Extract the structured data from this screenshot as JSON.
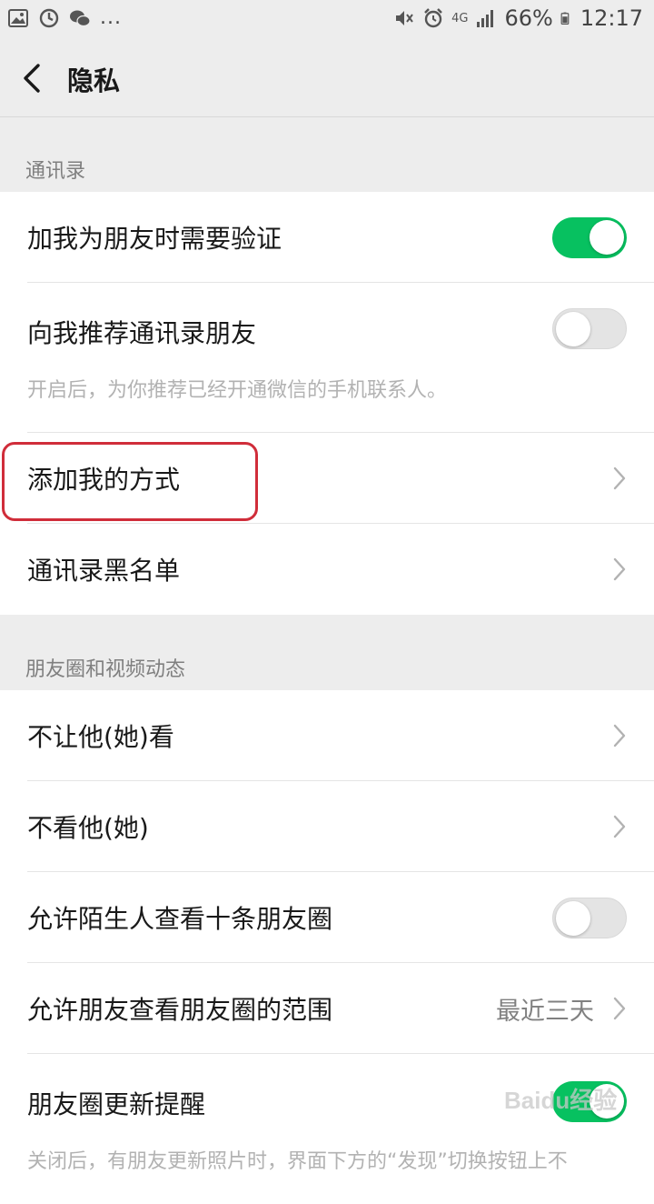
{
  "status_bar": {
    "left_icons": [
      "image-icon",
      "sync-icon",
      "wechat-icon"
    ],
    "more": "...",
    "network": "4G",
    "battery": "66%",
    "time": "12:17"
  },
  "nav": {
    "title": "隐私"
  },
  "sections": {
    "contacts": {
      "label": "通讯录",
      "require_verification": {
        "label": "加我为朋友时需要验证",
        "enabled": true
      },
      "recommend_contacts": {
        "label": "向我推荐通讯录朋友",
        "description": "开启后，为你推荐已经开通微信的手机联系人。",
        "enabled": false
      },
      "add_me_methods": {
        "label": "添加我的方式"
      },
      "blacklist": {
        "label": "通讯录黑名单"
      }
    },
    "moments": {
      "label": "朋友圈和视频动态",
      "hide_from": {
        "label": "不让他(她)看"
      },
      "hide_theirs": {
        "label": "不看他(她)"
      },
      "allow_strangers_ten": {
        "label": "允许陌生人查看十条朋友圈",
        "enabled": false
      },
      "visible_range": {
        "label": "允许朋友查看朋友圈的范围",
        "value": "最近三天"
      },
      "update_reminder": {
        "label": "朋友圈更新提醒",
        "description": "关闭后，有朋友更新照片时，界面下方的“发现”切换按钮上不",
        "enabled": true
      }
    }
  },
  "colors": {
    "accent_green": "#07c160",
    "highlight_red": "#d02d3a"
  },
  "watermark": "Baidu经验"
}
